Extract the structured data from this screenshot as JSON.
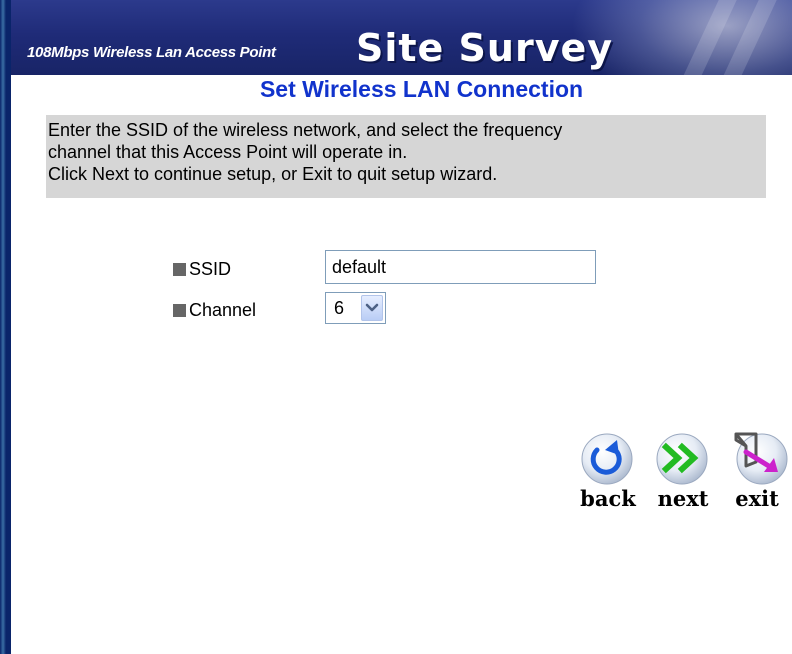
{
  "banner": {
    "subtitle": "108Mbps Wireless Lan Access Point",
    "title": "Site Survey"
  },
  "page": {
    "title": "Set Wireless LAN Connection"
  },
  "instructions": {
    "line1": "Enter the SSID of the wireless network, and select the frequency",
    "line2": "channel that this Access Point will operate in.",
    "line3": "Click Next to continue setup, or Exit to quit setup wizard."
  },
  "form": {
    "ssid_label": "SSID",
    "ssid_value": "default",
    "channel_label": "Channel",
    "channel_value": "6"
  },
  "nav": {
    "back_label": "back",
    "next_label": "next",
    "exit_label": "exit"
  },
  "colors": {
    "banner": "#1f2b78",
    "title_text": "#1133cc",
    "instructions_bg": "#d6d6d6",
    "bullet": "#666666"
  },
  "icons": {
    "back": "back-arrow-icon",
    "next": "next-arrow-icon",
    "exit": "exit-door-icon",
    "dropdown": "chevron-down-icon"
  }
}
